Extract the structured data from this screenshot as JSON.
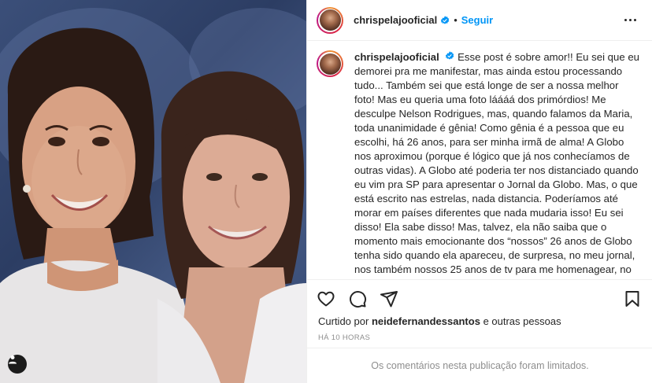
{
  "post": {
    "photo_alt": "",
    "user_tag_icon": "user-tag-icon"
  },
  "header": {
    "username": "chrispelajooficial",
    "verified_icon": "verified-badge-icon",
    "separator": "•",
    "follow_label": "Seguir",
    "more_icon": "more-options-icon"
  },
  "caption": {
    "username": "chrispelajooficial",
    "text": "Esse post é sobre amor!! Eu sei que eu demorei pra me manifestar, mas ainda estou processando tudo... Também sei que está longe de ser a nossa melhor foto! Mas eu queria uma foto láááá dos primórdios! Me desculpe Nelson Rodrigues, mas, quando falamos da Maria, toda unanimidade é gênia! Como gênia é a pessoa que eu escolhi, há 26 anos, para ser minha irmã de alma! A Globo nos aproximou (porque é lógico que já nos conhecíamos de outras vidas). A Globo até poderia ter nos distanciado quando eu vim pra SP para apresentar o Jornal da Globo. Mas, o que está escrito nas estrelas, nada distancia. Poderíamos até morar em países diferentes que nada mudaria isso! Eu sei disso! Ela sabe disso! Mas, talvez, ela não saiba que o momento mais emocionante dos “nossos” 26 anos de Globo tenha sido quando ela apareceu, de surpresa, no meu jornal, nos também nossos 25 anos de tv para me homenagear, no momento em que todas as homenagens tinham que ser pra ela!!! Ela acha (e eu sei que é verdadeiro) que eu sou a rainha do improviso. Mas, vamos combinar que esse"
  },
  "actions": {
    "like_icon": "heart-icon",
    "comment_icon": "comment-icon",
    "share_icon": "share-icon",
    "save_icon": "bookmark-icon"
  },
  "likes": {
    "prefix": "Curtido por",
    "user": "neidefernandessantos",
    "suffix": "e outras pessoas"
  },
  "timestamp": "HÁ 10 HORAS",
  "comments_notice": "Os comentários nesta publicação foram limitados.",
  "colors": {
    "accent": "#0095f6",
    "text": "#262626",
    "muted": "#8e8e8e",
    "border": "#efefef"
  }
}
